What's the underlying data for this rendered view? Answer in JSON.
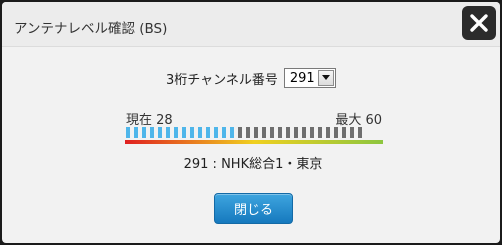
{
  "dialog": {
    "title": "アンテナレベル確認 (BS)",
    "close_icon": "close-icon"
  },
  "channel": {
    "label": "3桁チャンネル番号",
    "selected": "291",
    "dropdown_icon": "chevron-down-icon"
  },
  "level": {
    "current_label": "現在 28",
    "max_label": "最大 60",
    "current": 28,
    "max": 60,
    "filled_color": "#4fb6ea",
    "empty_color": "#6e6e6e",
    "gradient_colors": [
      "#e02020",
      "#f0d020",
      "#8dc63f"
    ]
  },
  "channel_name": "291 : NHK総合1・東京",
  "buttons": {
    "close_label": "閉じる"
  }
}
